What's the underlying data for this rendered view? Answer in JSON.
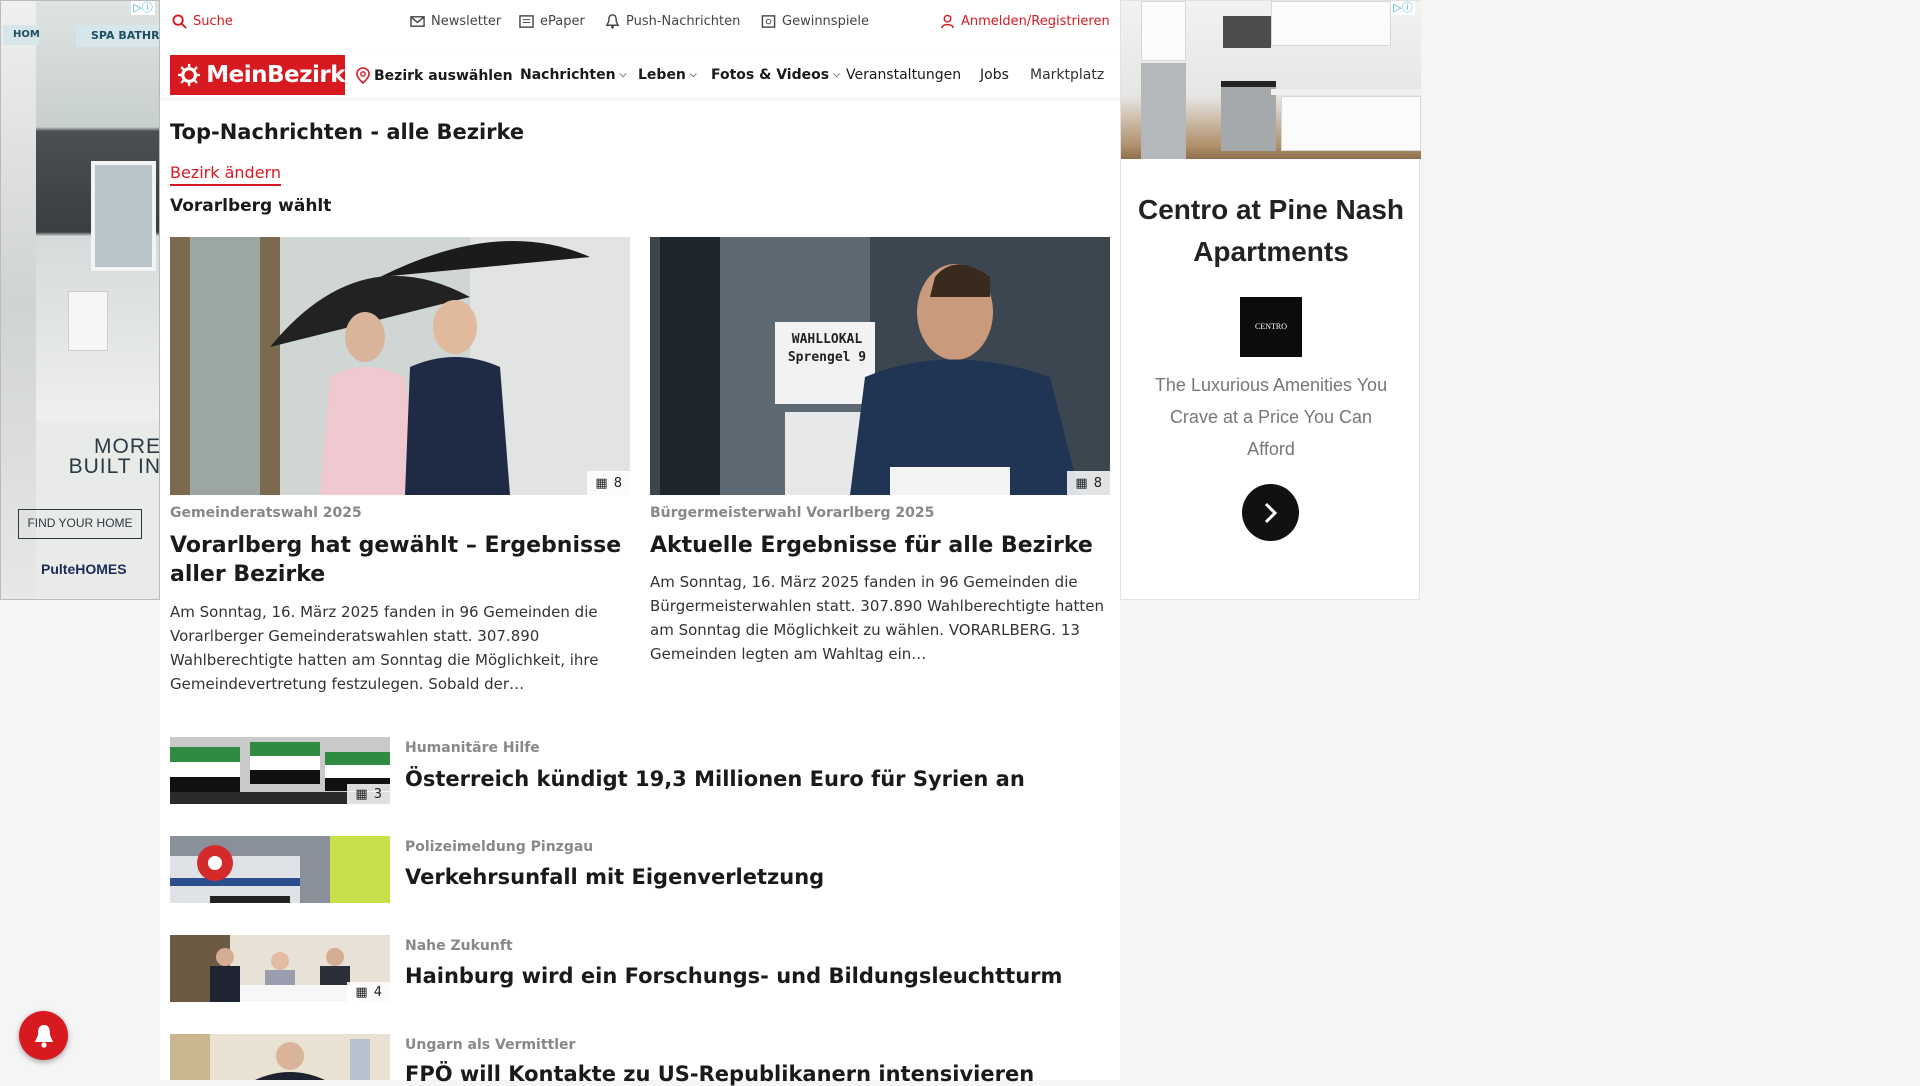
{
  "left_ad": {
    "tag_left": "HOM",
    "tag_right": "SPA BATHRO",
    "headline": "MORE\nBUILT IN",
    "cta": "FIND YOUR HOME",
    "brand": "PulteHOMES"
  },
  "utility": {
    "search": "Suche",
    "newsletter": "Newsletter",
    "epaper": "ePaper",
    "push": "Push-Nachrichten",
    "contests": "Gewinnspiele",
    "login": "Anmelden/Registrieren"
  },
  "nav": {
    "logo": "MeinBezirk",
    "district": "Bezirk auswählen",
    "items": [
      {
        "label": "Nachrichten",
        "dropdown": true
      },
      {
        "label": "Leben",
        "dropdown": true
      },
      {
        "label": "Fotos & Videos",
        "dropdown": true
      },
      {
        "label": "Veranstaltungen",
        "dropdown": false
      },
      {
        "label": "Jobs",
        "dropdown": false
      },
      {
        "label": "Marktplatz",
        "dropdown": false
      }
    ]
  },
  "section": {
    "title": "Top-Nachrichten - alle Bezirke",
    "change_link": "Bezirk ändern",
    "subtitle": "Vorarlberg wählt"
  },
  "featured": [
    {
      "kicker": "Gemeinderatswahl 2025",
      "headline": "Vorarlberg hat gewählt – Ergebnisse aller Bezirke",
      "teaser": "Am Sonntag, 16. März 2025 fanden in 96 Gemeinden die Vorarlberger Gemeinderatswahlen statt. 307.890 Wahlberechtigte hatten am Sonntag die Möglichkeit, ihre Gemeindevertretung festzulegen. Sobald der…",
      "photo_count": "8"
    },
    {
      "kicker": "Bürgermeisterwahl Vorarlberg 2025",
      "headline": "Aktuelle Ergebnisse für alle Bezirke",
      "teaser": "Am Sonntag, 16. März 2025 fanden in 96 Gemeinden die Bürgermeisterwahlen statt. 307.890 Wahlberechtigte hatten am Sonntag die Möglichkeit zu wählen. VORARLBERG. 13 Gemeinden legten am Wahltag ein…",
      "photo_count": "8",
      "sign_line1": "WAHLLOKAL",
      "sign_line2": "Sprengel 9"
    }
  ],
  "list": [
    {
      "kicker": "Humanitäre Hilfe",
      "headline": "Österreich kündigt 19,3 Millionen Euro für Syrien an",
      "photo_count": "3"
    },
    {
      "kicker": "Polizeimeldung Pinzgau",
      "headline": "Verkehrsunfall mit Eigenverletzung",
      "photo_count": ""
    },
    {
      "kicker": "Nahe Zukunft",
      "headline": "Hainburg wird ein Forschungs- und Bildungsleuchtturm",
      "photo_count": "4"
    },
    {
      "kicker": "Ungarn als Vermittler",
      "headline": "FPÖ will Kontakte zu US-Republikanern intensivieren",
      "photo_count": ""
    }
  ],
  "right_ad": {
    "title": "Centro at Pine Nash Apartments",
    "brand": "CENTRO",
    "description": "The Luxurious Amenities You Crave at a Price You Can Afford"
  },
  "colors": {
    "brand_red": "#d71920"
  }
}
